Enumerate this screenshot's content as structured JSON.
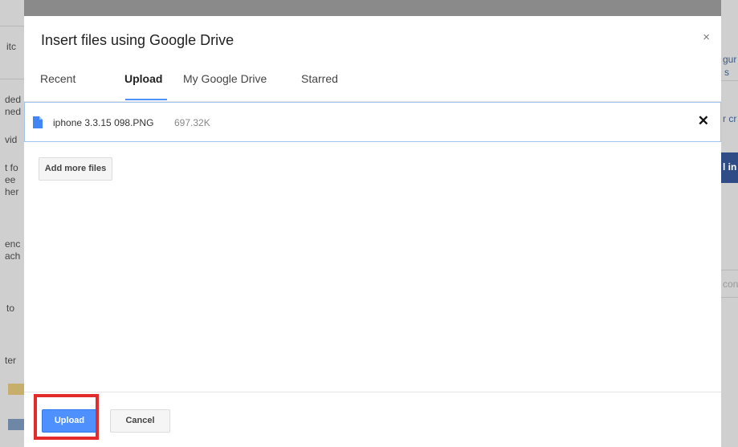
{
  "background_page": {
    "left_fragments": [
      "itc",
      "ded",
      "ned",
      "vid",
      "t fo",
      "ee",
      "her",
      "enc",
      "ach",
      "to",
      "ter"
    ],
    "right_fragments": [
      "gur",
      "s",
      "r cr",
      "l in",
      "con"
    ]
  },
  "dialog": {
    "title": "Insert files using Google Drive",
    "close_glyph": "×",
    "tabs": [
      {
        "label": "Recent",
        "active": false
      },
      {
        "label": "Upload",
        "active": true
      },
      {
        "label": "My Google Drive",
        "active": false
      },
      {
        "label": "Starred",
        "active": false
      }
    ],
    "file": {
      "name": "iphone 3.3.15 098.PNG",
      "size": "697.32K",
      "remove_glyph": "✕",
      "icon": "doc-icon",
      "icon_color": "#4285f4"
    },
    "add_more_label": "Add more files",
    "footer": {
      "upload_label": "Upload",
      "cancel_label": "Cancel"
    }
  },
  "colors": {
    "primary_blue": "#4d90fe",
    "highlight_red": "#e32b2b",
    "file_row_border": "#9fc2f0"
  }
}
